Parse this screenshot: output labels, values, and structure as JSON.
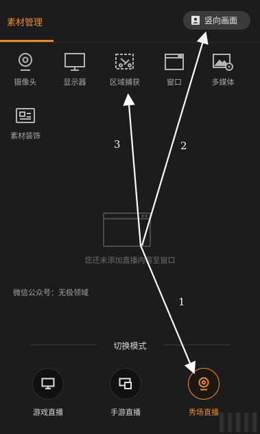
{
  "header": {
    "active_tab": "素材管理",
    "portrait_button": "竖向画面",
    "accent": "#f08a24"
  },
  "sources": [
    {
      "label": "摄像头",
      "icon": "webcam-icon"
    },
    {
      "label": "显示器",
      "icon": "monitor-icon"
    },
    {
      "label": "区域捕获",
      "icon": "region-capture-icon"
    },
    {
      "label": "窗口",
      "icon": "window-icon"
    },
    {
      "label": "多媒体",
      "icon": "media-icon"
    },
    {
      "label": "素材装饰",
      "icon": "decoration-icon"
    }
  ],
  "empty_state": {
    "icon": "empty-window-icon",
    "text": "您还未添加直播内容至窗口"
  },
  "wechat": "微信公众号：无极领域",
  "mode_switch": {
    "title": "切换模式",
    "modes": [
      {
        "label": "游戏直播",
        "icon": "monitor-icon",
        "active": false
      },
      {
        "label": "手游直播",
        "icon": "phone-cast-icon",
        "active": false
      },
      {
        "label": "秀场直播",
        "icon": "webcam-icon",
        "active": true
      }
    ]
  },
  "annotations": {
    "numbers": [
      "1",
      "2",
      "3"
    ]
  }
}
